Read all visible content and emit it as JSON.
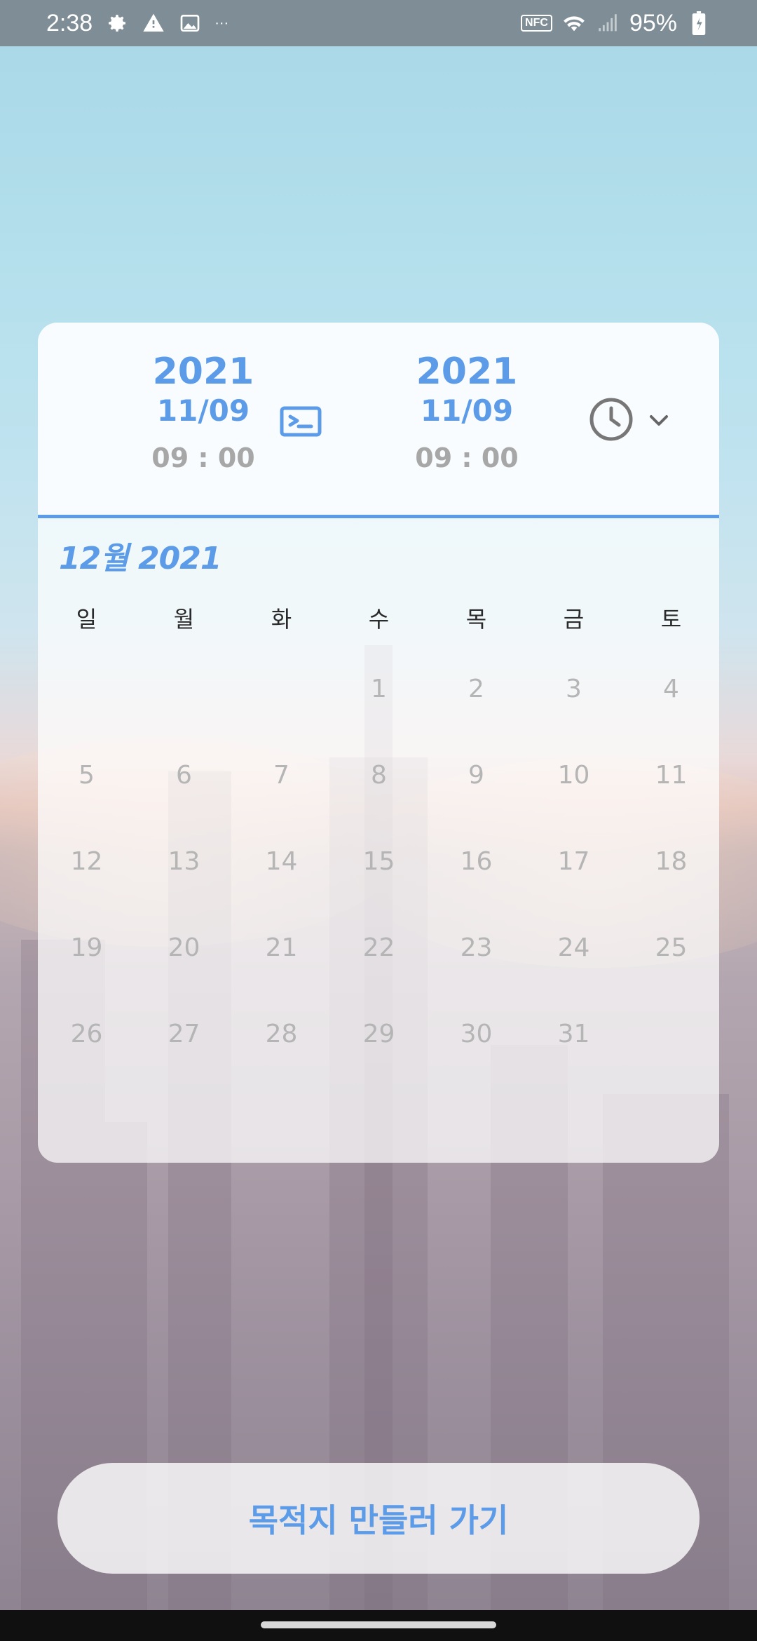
{
  "status_bar": {
    "time": "2:38",
    "icons_left": [
      "gear-icon",
      "alert-icon",
      "image-icon"
    ],
    "overflow": "···",
    "nfc": "NFC",
    "battery": "95%"
  },
  "schedule": {
    "start": {
      "year": "2021",
      "month_day": "11/09",
      "time": "09 : 00"
    },
    "end": {
      "year": "2021",
      "month_day": "11/09",
      "time": "09 : 00"
    }
  },
  "calendar": {
    "month_title": "12월 2021",
    "weekdays": [
      "일",
      "월",
      "화",
      "수",
      "목",
      "금",
      "토"
    ],
    "first_weekday_index": 3,
    "days_in_month": 31
  },
  "cta": {
    "label": "목적지 만들러 가기"
  },
  "colors": {
    "accent": "#5b9be8",
    "muted_text": "#b5b5b5",
    "status_bar": "#7f8e96"
  }
}
